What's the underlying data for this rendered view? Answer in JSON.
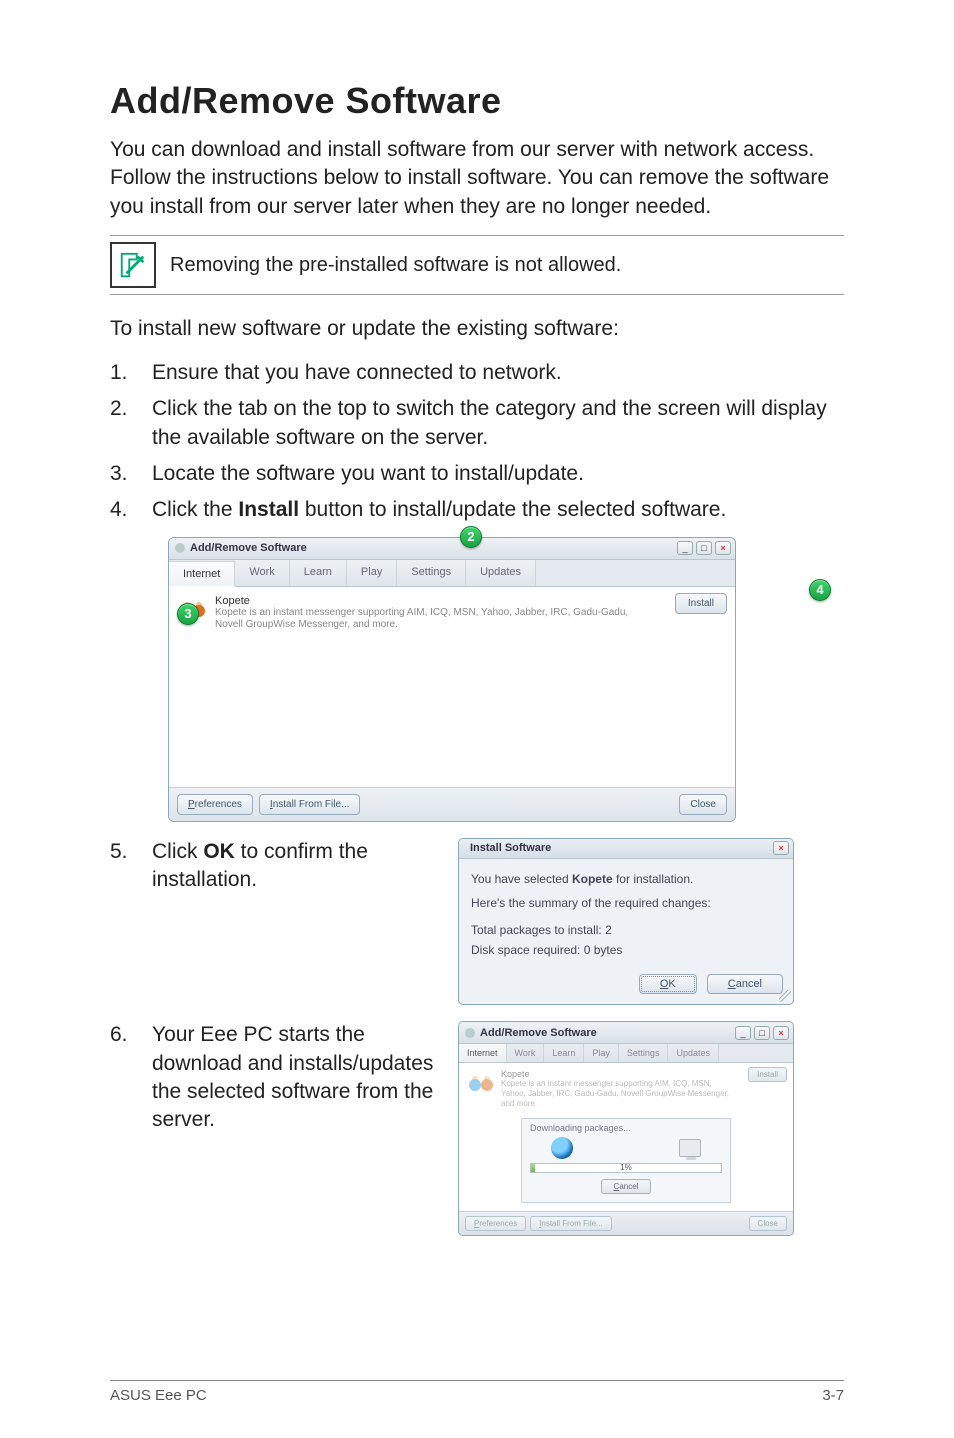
{
  "heading": "Add/Remove Software",
  "intro": "You can download and install software from our server with network access. Follow the instructions below to install software. You can remove the software you install from our server later when they are no longer needed.",
  "note": "Removing the pre-installed software is not allowed.",
  "lead": "To install new software or update the existing software:",
  "steps": {
    "s1": {
      "num": "1.",
      "text": "Ensure that you have connected to network."
    },
    "s2": {
      "num": "2.",
      "text": "Click the tab on the top to switch the category and the screen will display the available software on the server."
    },
    "s3": {
      "num": "3.",
      "text": "Locate the software you want to install/update."
    },
    "s4": {
      "num": "4.",
      "pre": "Click the ",
      "bold": "Install",
      "post": " button to install/update the selected software."
    },
    "s5": {
      "num": "5.",
      "pre": "Click ",
      "bold": "OK",
      "post": " to confirm the installation."
    },
    "s6": {
      "num": "6.",
      "text": "Your Eee PC starts the download and installs/updates the selected software from the server."
    }
  },
  "badges": {
    "b2": "2",
    "b3": "3",
    "b4": "4"
  },
  "win1": {
    "title": "Add/Remove Software",
    "tabs": {
      "internet": "Internet",
      "work": "Work",
      "learn": "Learn",
      "play": "Play",
      "settings": "Settings",
      "updates": "Updates"
    },
    "pkg": {
      "name": "Kopete",
      "desc": "Kopete is an instant messenger supporting AIM, ICQ, MSN, Yahoo, Jabber, IRC, Gadu-Gadu, Novell GroupWise Messenger, and more."
    },
    "install": "Install",
    "preferences": "Preferences",
    "install_from_file": "Install From File...",
    "close": "Close",
    "winbtns": {
      "min": "_",
      "max": "□",
      "close": "×"
    }
  },
  "dlg2": {
    "title": "Install Software",
    "selected_pre": "You have selected ",
    "selected_bold": "Kopete",
    "selected_post": " for installation.",
    "summary": "Here's the summary of the required changes:",
    "total": "Total packages to install: 2",
    "disk": "Disk space required:    0 bytes",
    "ok_u": "O",
    "ok_rest": "K",
    "cancel_u": "C",
    "cancel_rest": "ancel",
    "close": "×"
  },
  "win3": {
    "title": "Add/Remove Software",
    "tabs": {
      "internet": "Internet",
      "work": "Work",
      "learn": "Learn",
      "play": "Play",
      "settings": "Settings",
      "updates": "Updates"
    },
    "pkg": {
      "name": "Kopete",
      "desc": "Kopete is an instant messenger supporting AIM, ICQ, MSN, Yahoo, Jabber, IRC, Gadu-Gadu, Novell GroupWise Messenger, and more."
    },
    "install": "Install",
    "dl_title": "Downloading packages...",
    "pct": "1%",
    "cancel_u": "C",
    "cancel_rest": "ancel",
    "preferences_u": "P",
    "preferences_rest": "references",
    "install_file_u": "I",
    "install_file_rest": "nstall From File...",
    "close": "Close",
    "winbtns": {
      "min": "_",
      "max": "□",
      "close": "×"
    }
  },
  "footer": {
    "left": "ASUS Eee PC",
    "right": "3-7"
  }
}
